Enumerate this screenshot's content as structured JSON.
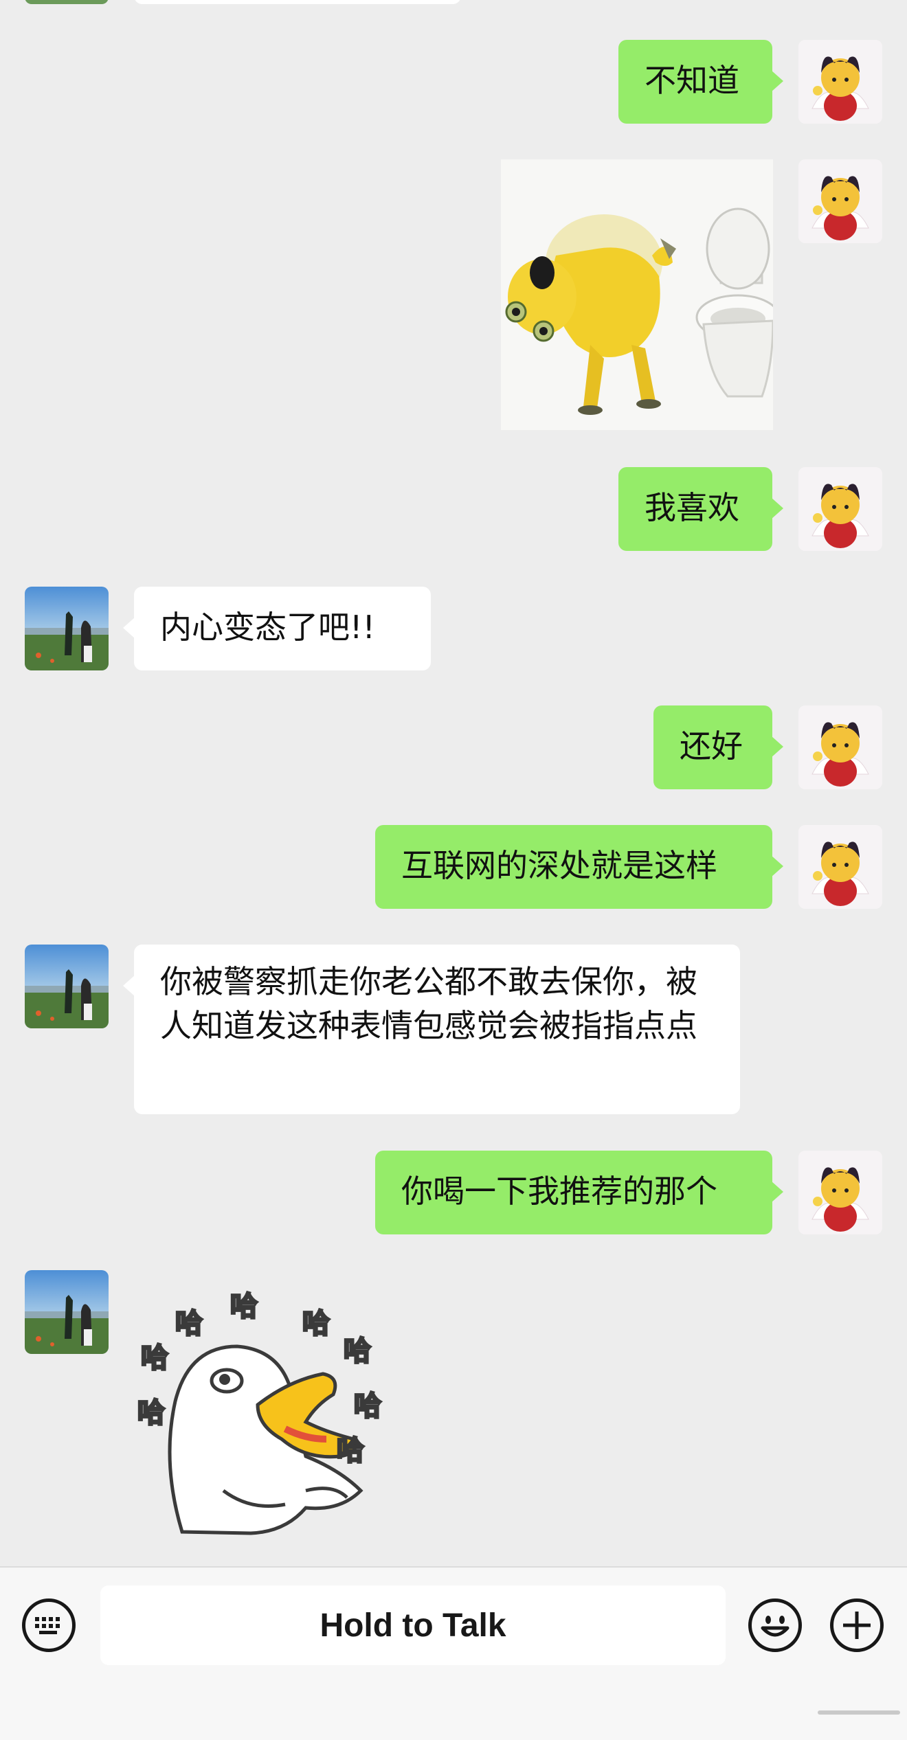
{
  "messages": [
    {
      "from": "me",
      "text": "不知道"
    },
    {
      "from": "me",
      "sticker": "yellow-creature-at-toilet-sticker"
    },
    {
      "from": "me",
      "text": "我喜欢"
    },
    {
      "from": "them",
      "text": "内心变态了吧!!"
    },
    {
      "from": "me",
      "text": "还好"
    },
    {
      "from": "me",
      "text": "互联网的深处就是这样"
    },
    {
      "from": "them",
      "text": "你被警察抓走你老公都不敢去保你，被人知道发这种表情包感觉会被指指点点"
    },
    {
      "from": "me",
      "text": "你喝一下我推荐的那个"
    },
    {
      "from": "them",
      "sticker": "laughing-duck-sticker",
      "sticker_text": "哈"
    }
  ],
  "input_bar": {
    "hold_to_talk_label": "Hold to Talk",
    "icons": [
      "keyboard-icon",
      "emoji-icon",
      "plus-icon"
    ]
  },
  "colors": {
    "background": "#ededed",
    "my_bubble": "#95ec69",
    "their_bubble": "#ffffff"
  }
}
